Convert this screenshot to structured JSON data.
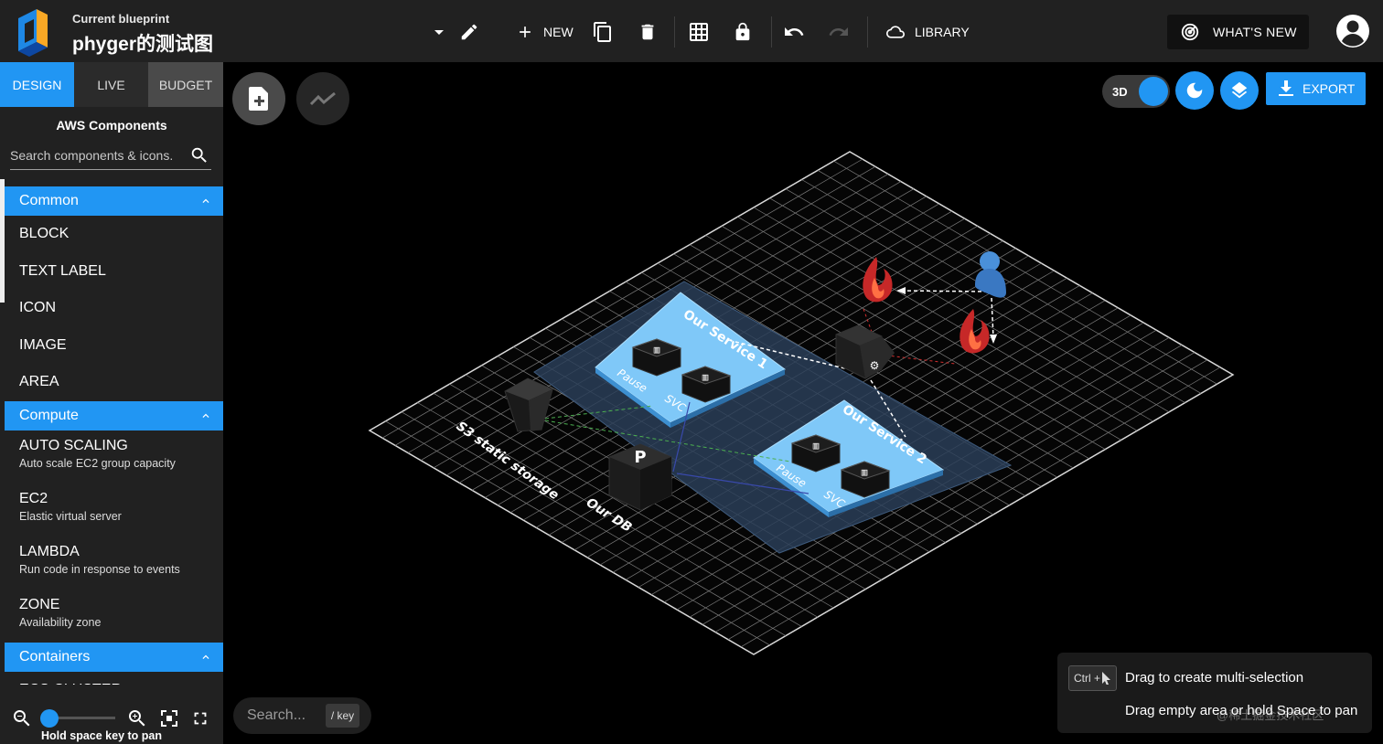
{
  "header": {
    "blueprint_caption": "Current blueprint",
    "blueprint_name": "phyger的测试图",
    "new_label": "NEW",
    "library_label": "LIBRARY",
    "whats_new_label": "WHAT'S NEW"
  },
  "sidebar": {
    "tabs": [
      {
        "label": "DESIGN",
        "active": true
      },
      {
        "label": "LIVE",
        "active": false
      },
      {
        "label": "BUDGET",
        "active": false
      }
    ],
    "title": "AWS Components",
    "search_placeholder": "Search components & icons.",
    "categories": [
      {
        "label": "Common",
        "items": [
          {
            "name": "BLOCK"
          },
          {
            "name": "TEXT LABEL"
          },
          {
            "name": "ICON"
          },
          {
            "name": "IMAGE"
          },
          {
            "name": "AREA"
          }
        ]
      },
      {
        "label": "Compute",
        "items": [
          {
            "name": "AUTO SCALING",
            "desc": "Auto scale EC2 group capacity"
          },
          {
            "name": "EC2",
            "desc": "Elastic virtual server"
          },
          {
            "name": "LAMBDA",
            "desc": "Run code in response to events"
          },
          {
            "name": "ZONE",
            "desc": "Availability zone"
          }
        ]
      },
      {
        "label": "Containers",
        "items": [
          {
            "name": "ECS CLUSTER"
          }
        ]
      }
    ],
    "zoom_hint": "Hold space key to pan",
    "zoom_level": 0.1
  },
  "canvas": {
    "toggle_3d_label": "3D",
    "export_label": "EXPORT",
    "search_placeholder": "Search...",
    "search_key_hint": "/ key",
    "hints": {
      "ctrl_chip": "Ctrl +",
      "multi_select": "Drag to create multi-selection",
      "pan": "Drag empty area or hold Space to pan"
    },
    "watermark": "@稀土掘金技术社区",
    "diagram": {
      "area_labels": [
        "Our Service 1",
        "Our Service 2"
      ],
      "pod_labels": [
        "Pause",
        "SVC"
      ],
      "component_labels": [
        "S3 static storage",
        "Our DB"
      ]
    }
  },
  "colors": {
    "accent": "#2196f3",
    "toolbar_bg": "#212121",
    "canvas_bg": "#000000",
    "area_fill": "#7fc8f8",
    "zone_fill": "#2a3e58"
  }
}
